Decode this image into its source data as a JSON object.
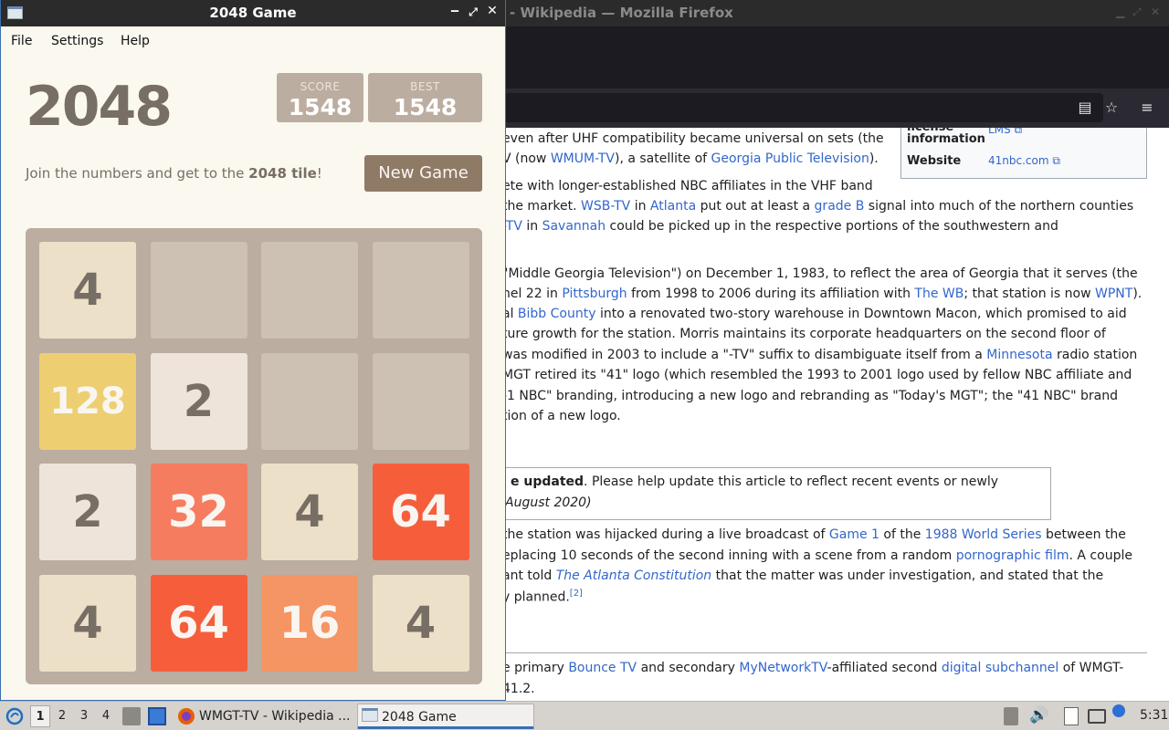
{
  "firefox": {
    "title": "- Wikipedia — Mozilla Firefox",
    "infobox": {
      "license_label_1": "license",
      "license_label_2": "information",
      "license_value": "LMS",
      "website_label": "Website",
      "website_value": "41nbc.com"
    },
    "lines": [
      {
        "pre": "even after UHF compatibility became universal on sets (the",
        "links": []
      },
      {
        "pre": "V (now ",
        "l1": "WMUM-TV",
        "mid": "), a satellite of ",
        "l2": "Georgia Public Television",
        "post": ")."
      },
      {
        "pre": "ete with longer-established NBC affiliates in the VHF band"
      },
      {
        "pre": "the market. ",
        "l1": "WSB-TV",
        "mid": " in ",
        "l2": "Atlanta",
        "mid2": " put out at least a ",
        "l3": "grade B",
        "post": " signal into much of the northern counties"
      },
      {
        "l1": "-TV",
        "mid": " in ",
        "l2": "Savannah",
        "post": " could be picked up in the respective portions of the southwestern and"
      },
      {
        "pre": "\"Middle Georgia Television\") on December 1, 1983, to reflect the area of Georgia that it serves (the"
      },
      {
        "pre": "nel 22 in ",
        "l1": "Pittsburgh",
        "mid": " from 1998 to 2006 during its affiliation with ",
        "l2": "The WB",
        "mid2": "; that station is now ",
        "l3": "WPNT",
        "post": ")."
      },
      {
        "pre": "al ",
        "l1": "Bibb County",
        "post": " into a renovated two-story warehouse in Downtown Macon, which promised to aid"
      },
      {
        "pre": "ture growth for the station. Morris maintains its corporate headquarters on the second floor of"
      },
      {
        "pre": "was modified in 2003 to include a \"-TV\" suffix to disambiguate itself from a ",
        "l1": "Minnesota",
        "post": " radio station"
      },
      {
        "pre": "MGT retired its \"41\" logo (which resembled the 1993 to 2001 logo used by fellow NBC affiliate and"
      },
      {
        "pre": "-1 NBC\" branding, introducing a new logo and rebranding as \"Today's MGT\"; the \"41 NBC\" brand"
      },
      {
        "pre": "tion of a new logo."
      }
    ],
    "notice_bold": "e updated",
    "notice_rest": ". Please help update this article to reflect recent events or newly",
    "notice_date": "August 2020)",
    "lines2": [
      {
        "pre": " the station was hijacked during a live broadcast of ",
        "l1": "Game 1",
        "mid": " of the ",
        "l2": "1988 World Series",
        "post": " between the"
      },
      {
        "pre": "eplacing 10 seconds of the second inning with a scene from a random ",
        "l1": "pornographic film",
        "post": ". A couple"
      },
      {
        "pre": "ant told ",
        "l1": "The Atlanta Constitution",
        "post": " that the matter was under investigation, and stated that the"
      },
      {
        "pre": "y planned.",
        "sup": "[2]"
      }
    ],
    "lines3": [
      {
        "pre": "e primary ",
        "l1": "Bounce TV",
        "mid": " and secondary ",
        "l2": "MyNetworkTV",
        "mid2": "-affiliated second ",
        "l3": "digital subchannel",
        "post": " of WMGT-"
      },
      {
        "pre": " 41.2."
      }
    ]
  },
  "game": {
    "window_title": "2048 Game",
    "menu": [
      "File",
      "Settings",
      "Help"
    ],
    "heading": "2048",
    "score_label": "SCORE",
    "score": "1548",
    "best_label": "BEST",
    "best": "1548",
    "intro_pre": "Join the numbers and get to the ",
    "intro_bold": "2048 tile",
    "intro_post": "!",
    "new_game": "New Game",
    "grid": [
      [
        "4",
        "",
        "",
        ""
      ],
      [
        "128",
        "2",
        "",
        ""
      ],
      [
        "2",
        "32",
        "4",
        "64"
      ],
      [
        "4",
        "64",
        "16",
        "4"
      ]
    ],
    "tile_colors": {
      "empty": "#cdc1b4",
      "2": "#eee4da",
      "4": "#ede0c8",
      "16": "#f59563",
      "32": "#f67c5f",
      "64": "#f65e3b",
      "128": "#edcf72"
    }
  },
  "taskbar": {
    "workspaces": [
      "1",
      "2",
      "3",
      "4"
    ],
    "task_firefox": "WMGT-TV - Wikipedia ...",
    "task_game": "2048 Game",
    "clock": "5:31"
  }
}
